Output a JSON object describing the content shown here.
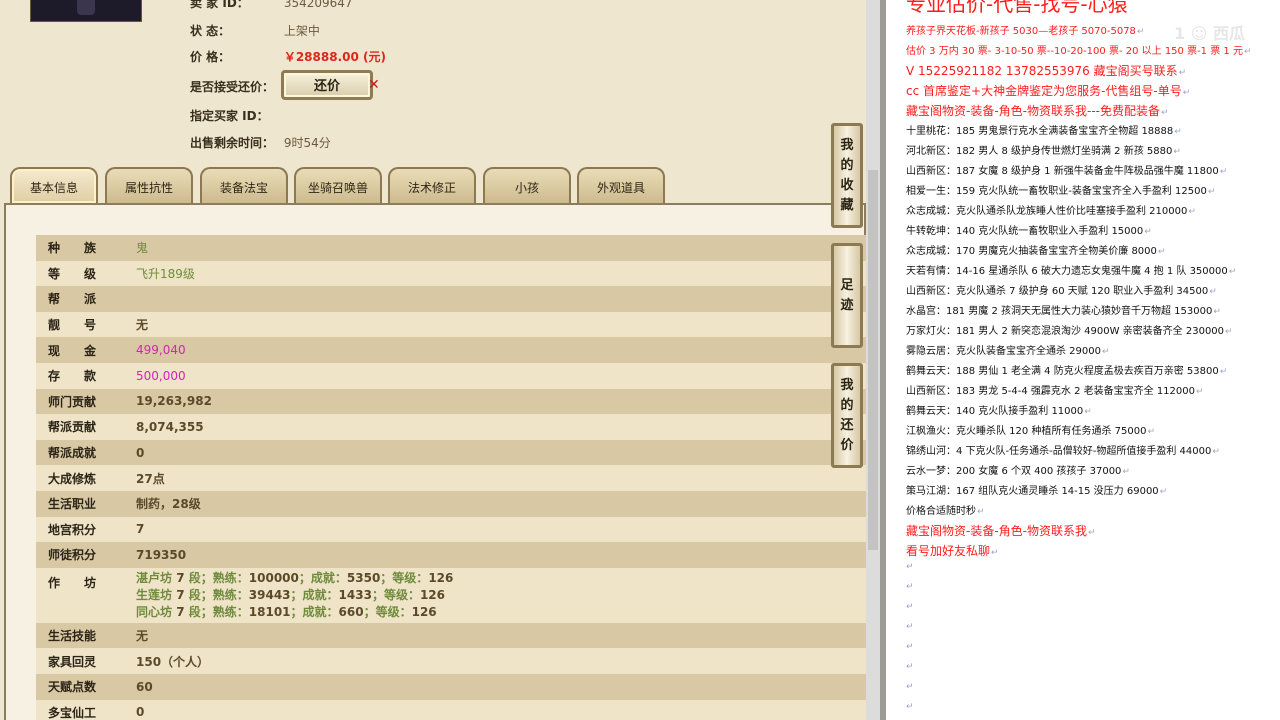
{
  "listing": {
    "seller_label": "卖 家  ID：",
    "seller_id": "354209647",
    "status_label": "状      态：",
    "status_value": "上架中",
    "price_label": "价      格：",
    "price_value": "￥28888.00 (元)",
    "accept_label": "是否接受还价：",
    "offer_button": "还价",
    "buyer_label": "指定买家 ID：",
    "time_label": "出售剩余时间：",
    "time_value": "9时54分"
  },
  "tabs": [
    {
      "label": "基本信息"
    },
    {
      "label": "属性抗性"
    },
    {
      "label": "装备法宝"
    },
    {
      "label": "坐骑召唤兽"
    },
    {
      "label": "法术修正"
    },
    {
      "label": "小孩"
    },
    {
      "label": "外观道具"
    }
  ],
  "attributes": [
    {
      "k1": "种",
      "k2": "族",
      "value": "鬼"
    },
    {
      "k1": "等",
      "k2": "级",
      "value": "飞升189级"
    },
    {
      "k1": "帮",
      "k2": "派",
      "value": ""
    },
    {
      "k1": "靓",
      "k2": "号",
      "value": "无"
    },
    {
      "k1": "现",
      "k2": "金",
      "value": "499,040"
    },
    {
      "k1": "存",
      "k2": "款",
      "value": "500,000"
    },
    {
      "label": "师门贡献",
      "value": "19,263,982"
    },
    {
      "label": "帮派贡献",
      "value": "8,074,355"
    },
    {
      "label": "帮派成就",
      "value": "0"
    },
    {
      "label": "大成修炼",
      "value": "27点"
    },
    {
      "label": "生活职业",
      "value": "制药，28级"
    },
    {
      "label": "地宫积分",
      "value": "7"
    },
    {
      "label": "师徒积分",
      "value": "719350"
    }
  ],
  "workshop": {
    "k1": "作",
    "k2": "坊",
    "lines": [
      {
        "name": "湛卢坊",
        "level": "7",
        "skill": "100000",
        "achieve": "5350",
        "grade": "126"
      },
      {
        "name": "生莲坊",
        "level": "7",
        "skill": "39443",
        "achieve": "1433",
        "grade": "126"
      },
      {
        "name": "同心坊",
        "level": "7",
        "skill": "18101",
        "achieve": "660",
        "grade": "126"
      }
    ],
    "seg": "段；熟练：",
    "ach_label": "；成就：",
    "grade_label": "；等级："
  },
  "attributes_more": [
    {
      "label": "生活技能",
      "value": "无"
    },
    {
      "label": "家具回灵",
      "value": "150（个人）"
    },
    {
      "label": "天赋点数",
      "value": "60"
    },
    {
      "label": "多宝仙工",
      "value": "0"
    }
  ],
  "side_buttons": {
    "collect": [
      "我",
      "的",
      "收",
      "藏"
    ],
    "footprint": [
      "足",
      "迹"
    ],
    "myoffer": [
      "我",
      "的",
      "还",
      "价"
    ]
  },
  "doc": {
    "title": "专业估价-代售-找号-心猿",
    "watermark": "1 ☺ 西瓜",
    "lines": [
      {
        "text": "养孩子界天花板-新孩子 5030—老孩子 5070-5078",
        "red": true
      },
      {
        "text": "估价 3 万内 30 票- 3-10-50 票--10-20-100 票- 20 以上 150 票-1 票 1 元",
        "red": true
      },
      {
        "text": "V 15225921182      13782553976    藏宝阁买号联系",
        "red": true,
        "big": true
      },
      {
        "text": "cc 首席鉴定+大神金牌鉴定为您服务-代售组号-单号",
        "red": true,
        "big": true
      },
      {
        "text": "藏宝阁物资-装备-角色-物资联系我---免费配装备",
        "red": true,
        "big": true
      },
      {
        "text": "十里桃花：185 男鬼景行克水全满装备宝宝齐全物超 18888"
      },
      {
        "text": "河北新区：182 男人 8 级护身传世燃灯坐骑满 2 新孩 5880"
      },
      {
        "text": "山西新区：187 女魔 8 级护身 1 新强牛装备金牛阵极品强牛魔 11800"
      },
      {
        "text": "相爱一生：159 克火队统一畜牧职业-装备宝宝齐全入手盈利 12500"
      },
      {
        "text": "众志成城：克火队通杀队龙族睡人性价比哇塞接手盈利 210000"
      },
      {
        "text": "牛转乾坤：140 克火队统一畜牧职业入手盈利 15000"
      },
      {
        "text": "众志成城：170 男魔克火抽装备宝宝齐全物美价廉 8000"
      },
      {
        "text": "天若有情：14-16 星通杀队 6 破大力遗忘女鬼强牛魔 4 抱 1 队 350000"
      },
      {
        "text": "山西新区：克火队通杀 7 级护身 60 天赋 120 职业入手盈利 34500"
      },
      {
        "text": "水晶宫：181 男魔 2 孩洞天无属性大力装心猿妙音千万物超 153000"
      },
      {
        "text": "万家灯火：181 男人 2 新突恋混浪淘沙 4900W 亲密装备齐全 230000"
      },
      {
        "text": "雾隐云居：克火队装备宝宝齐全通杀 29000"
      },
      {
        "text": "鹤舞云天：188 男仙 1 老全满 4 防克火程度孟极去疾百万亲密 53800"
      },
      {
        "text": "山西新区：183 男龙 5-4-4 强霹克水 2 老装备宝宝齐全 112000"
      },
      {
        "text": "鹤舞云天：140 克火队接手盈利 11000"
      },
      {
        "text": "江枫渔火：克火睡杀队 120 种植所有任务通杀 75000"
      },
      {
        "text": "锦绣山河：4 下克火队-任务通杀-品僧较好-物超所值接手盈利 44000"
      },
      {
        "text": "云水一梦：200 女魔 6 个双 400 孩孩子 37000"
      },
      {
        "text": "策马江湖：167 组队克火通灵睡杀 14-15 没压力 69000"
      },
      {
        "text": "价格合适随时秒"
      },
      {
        "text": "藏宝阁物资-装备-角色-物资联系我",
        "red": true,
        "big": true
      },
      {
        "text": "看号加好友私聊",
        "red": true,
        "big": true
      }
    ],
    "para_mark": "↵"
  }
}
